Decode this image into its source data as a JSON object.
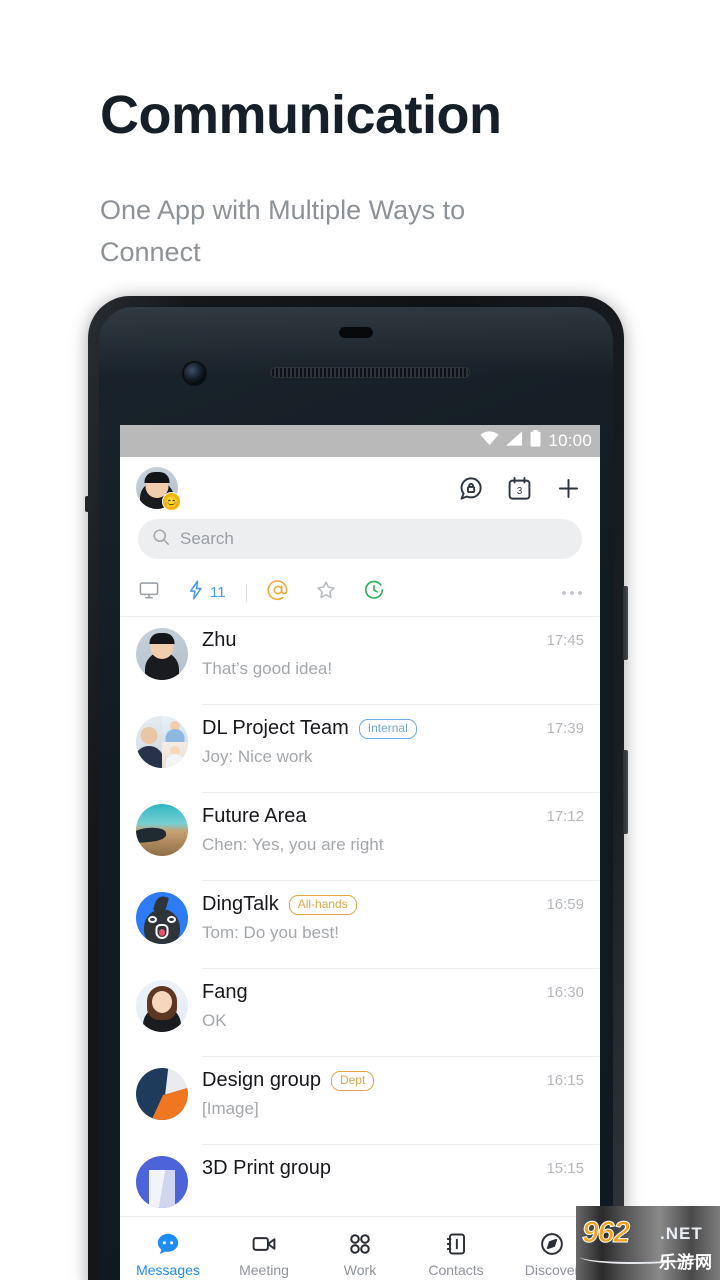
{
  "hero": {
    "title": "Communication",
    "subtitle": "One App with Multiple Ways to Connect"
  },
  "colors": {
    "accent_blue": "#1f8cf5",
    "tag_blue": "#6fa9e8",
    "tag_amber": "#e0a74a",
    "bolt_blue": "#4a9bf0",
    "at_orange": "#f0a93c",
    "clock_green": "#2bb455",
    "status_bar": "#b9b9b9",
    "title": "#161e27",
    "subtitle": "#8d9299"
  },
  "phone": {
    "status_bar": {
      "time": "10:00",
      "icons": [
        "wifi-icon",
        "cellular-signal-icon",
        "battery-icon"
      ]
    },
    "appbar": {
      "avatar": "user-avatar",
      "emoji_badge": "😊",
      "icons": [
        {
          "name": "secure-chat-icon",
          "label": "Secure Chat"
        },
        {
          "name": "calendar-icon",
          "label": "Calendar",
          "badge": "3"
        },
        {
          "name": "plus-icon",
          "label": "Add"
        }
      ]
    },
    "search": {
      "placeholder": "Search",
      "icon": "search-icon"
    },
    "filters": [
      {
        "name": "desktop-icon",
        "label": "Desktop",
        "badge": "",
        "color": "#9aa0a6"
      },
      {
        "name": "bolt-icon",
        "label": "Quick",
        "badge": "11",
        "color": "#4a9bf0"
      },
      {
        "name": "mention-icon",
        "label": "Mentions",
        "badge": "",
        "color": "#f0a93c"
      },
      {
        "name": "star-icon",
        "label": "Starred",
        "badge": "",
        "color": "#b9bdc2"
      },
      {
        "name": "clock-icon",
        "label": "Pending",
        "badge": "",
        "color": "#2bb455"
      }
    ],
    "filters_more": "more-options-icon",
    "chats": [
      {
        "name": "Zhu",
        "tag": "",
        "tag_style": "",
        "message": "That’s good idea!",
        "time": "17:45",
        "avatar": "avatar-zhu"
      },
      {
        "name": "DL Project Team",
        "tag": "Internal",
        "tag_style": "blue",
        "message": "Joy: Nice work",
        "time": "17:39",
        "avatar": "avatar-group"
      },
      {
        "name": "Future Area",
        "tag": "",
        "tag_style": "",
        "message": "Chen: Yes, you are right",
        "time": "17:12",
        "avatar": "avatar-future"
      },
      {
        "name": "DingTalk",
        "tag": "All-hands",
        "tag_style": "amber",
        "message": "Tom: Do you best!",
        "time": "16:59",
        "avatar": "avatar-dingtalk"
      },
      {
        "name": "Fang",
        "tag": "",
        "tag_style": "",
        "message": "OK",
        "time": "16:30",
        "avatar": "avatar-fang"
      },
      {
        "name": "Design group",
        "tag": "Dept",
        "tag_style": "amber",
        "message": "[Image]",
        "time": "16:15",
        "avatar": "avatar-design"
      },
      {
        "name": "3D Print group",
        "tag": "",
        "tag_style": "",
        "message": "",
        "time": "15:15",
        "avatar": "avatar-3dprint"
      }
    ],
    "bottom_nav": [
      {
        "label": "Messages",
        "icon": "messages-icon",
        "active": true
      },
      {
        "label": "Meeting",
        "icon": "video-camera-icon",
        "active": false
      },
      {
        "label": "Work",
        "icon": "grid-apps-icon",
        "active": false
      },
      {
        "label": "Contacts",
        "icon": "contacts-book-icon",
        "active": false
      },
      {
        "label": "Discover",
        "icon": "compass-icon",
        "active": false
      }
    ]
  },
  "watermark": {
    "brand": "962",
    "tld": ".NET",
    "cn": "乐游网"
  }
}
